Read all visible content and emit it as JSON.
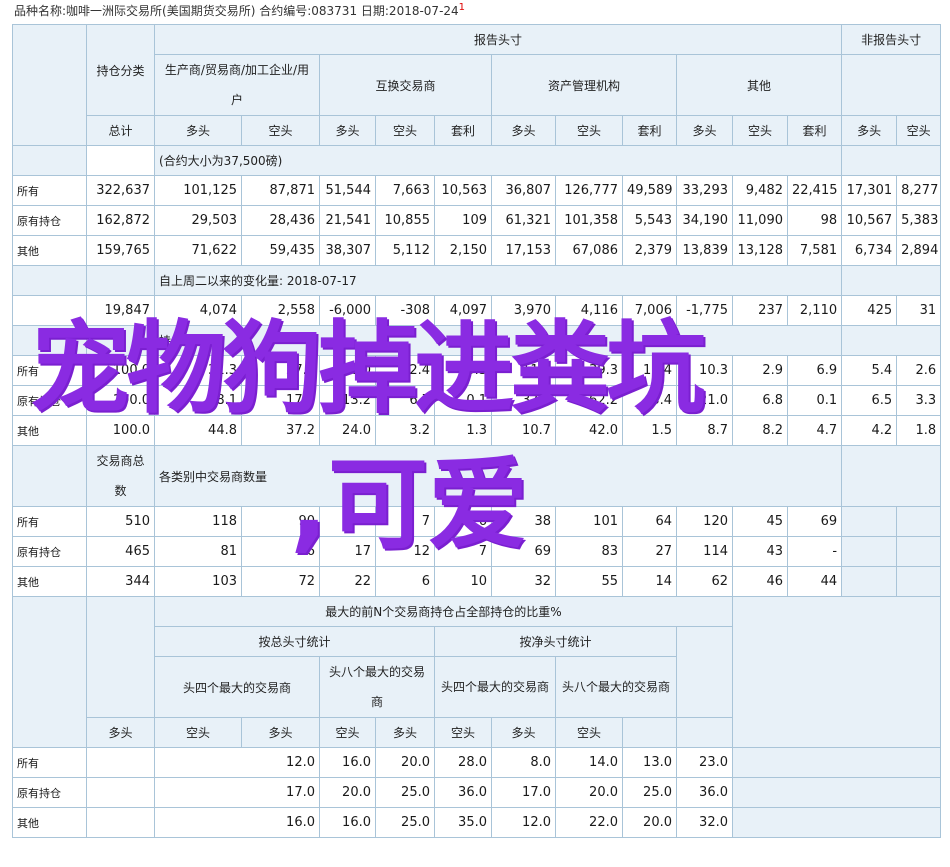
{
  "header": {
    "line": "品种名称:咖啡一洲际交易所(美国期货交易所)   合约编号:083731   日期:2018-07-24",
    "mark": "1"
  },
  "labels": {
    "reported": "报告头寸",
    "nonreported": "非报告头寸",
    "category": "持仓分类",
    "producer": "生产商/贸易商/加工企业/用户",
    "swap": "互换交易商",
    "managed": "资产管理机构",
    "other": "其他",
    "total": "总计",
    "long": "多头",
    "short": "空头",
    "spread": "套利"
  },
  "section1": {
    "band": "(合约大小为37,500磅)",
    "rows": [
      {
        "label": "所有",
        "v": [
          "322,637",
          "101,125",
          "87,871",
          "51,544",
          "7,663",
          "10,563",
          "36,807",
          "126,777",
          "49,589",
          "33,293",
          "9,482",
          "22,415",
          "17,301",
          "8,277"
        ]
      },
      {
        "label": "原有持仓",
        "v": [
          "162,872",
          "29,503",
          "28,436",
          "21,541",
          "10,855",
          "109",
          "61,321",
          "101,358",
          "5,543",
          "34,190",
          "11,090",
          "98",
          "10,567",
          "5,383"
        ]
      },
      {
        "label": "其他",
        "v": [
          "159,765",
          "71,622",
          "59,435",
          "38,307",
          "5,112",
          "2,150",
          "17,153",
          "67,086",
          "2,379",
          "13,839",
          "13,128",
          "7,581",
          "6,734",
          "2,894"
        ]
      }
    ]
  },
  "section2": {
    "band": "自上周二以来的变化量: 2018-07-17",
    "row": [
      "19,847",
      "4,074",
      "2,558",
      "-6,000",
      "-308",
      "4,097",
      "3,970",
      "4,116",
      "7,006",
      "-1,775",
      "237",
      "2,110",
      "425",
      "31"
    ]
  },
  "section3": {
    "band": "持仓占比",
    "rows": [
      {
        "label": "所有",
        "v": [
          "100.0",
          "31.3",
          "27.2",
          "16.0",
          "2.4",
          "3.3",
          "11.4",
          "39.3",
          "15.4",
          "10.3",
          "2.9",
          "6.9",
          "5.4",
          "2.6"
        ]
      },
      {
        "label": "原有持仓",
        "v": [
          "100.0",
          "18.1",
          "17.5",
          "13.2",
          "6.7",
          "0.1",
          "37.6",
          "62.2",
          "3.4",
          "21.0",
          "6.8",
          "0.1",
          "6.5",
          "3.3"
        ]
      },
      {
        "label": "其他",
        "v": [
          "100.0",
          "44.8",
          "37.2",
          "24.0",
          "3.2",
          "1.3",
          "10.7",
          "42.0",
          "1.5",
          "8.7",
          "8.2",
          "4.7",
          "4.2",
          "1.8"
        ]
      }
    ]
  },
  "section4": {
    "head": "交易商总数",
    "band": "各类别中交易商数量",
    "rows": [
      {
        "label": "所有",
        "v": [
          "510",
          "118",
          "90",
          "20",
          "7",
          "26",
          "38",
          "101",
          "64",
          "120",
          "45",
          "69",
          "",
          ""
        ]
      },
      {
        "label": "原有持仓",
        "v": [
          "465",
          "81",
          "76",
          "17",
          "12",
          "7",
          "69",
          "83",
          "27",
          "114",
          "43",
          "-",
          "",
          ""
        ]
      },
      {
        "label": "其他",
        "v": [
          "344",
          "103",
          "72",
          "22",
          "6",
          "10",
          "32",
          "55",
          "14",
          "62",
          "46",
          "44",
          "",
          ""
        ]
      }
    ]
  },
  "section5": {
    "band": "最大的前N个交易商持仓占全部持仓的比重%",
    "gross": "按总头寸统计",
    "net": "按净头寸统计",
    "top4": "头四个最大的交易商",
    "top8": "头八个最大的交易商",
    "rows": [
      {
        "label": "所有",
        "v": [
          "12.0",
          "16.0",
          "20.0",
          "28.0",
          "8.0",
          "14.0",
          "13.0",
          "23.0"
        ]
      },
      {
        "label": "原有持仓",
        "v": [
          "17.0",
          "20.0",
          "25.0",
          "36.0",
          "17.0",
          "20.0",
          "25.0",
          "36.0"
        ]
      },
      {
        "label": "其他",
        "v": [
          "16.0",
          "16.0",
          "25.0",
          "35.0",
          "12.0",
          "22.0",
          "20.0",
          "32.0"
        ]
      }
    ]
  },
  "overlay": {
    "line1": "宠物狗掉进粪坑",
    "line2": ",可爱",
    "color": "#8a2be2"
  }
}
